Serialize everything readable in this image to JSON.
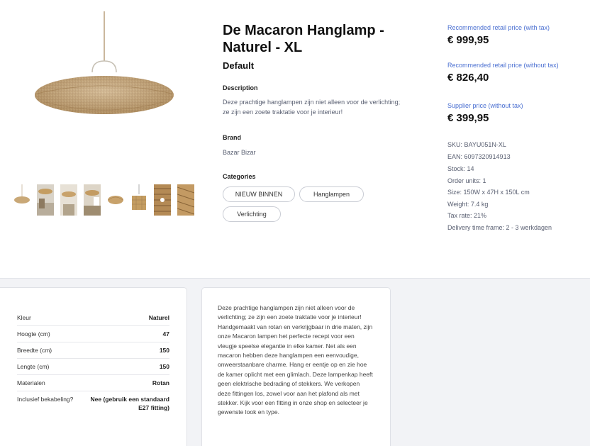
{
  "product": {
    "title": "De Macaron Hanglamp - Naturel - XL",
    "variant": "Default",
    "description_label": "Description",
    "description": "Deze prachtige hanglampen zijn niet alleen voor de verlichting; ze zijn een zoete traktatie voor je interieur!",
    "brand_label": "Brand",
    "brand": "Bazar Bizar",
    "categories_label": "Categories",
    "categories": [
      "NIEUW BINNEN",
      "Hanglampen",
      "Verlichting"
    ]
  },
  "pricing": {
    "retail_with_tax_label": "Recommended retail price (with tax)",
    "retail_with_tax": "€ 999,95",
    "retail_without_tax_label": "Recommended retail price (without tax)",
    "retail_without_tax": "€ 826,40",
    "supplier_label": "Supplier price (without tax)",
    "supplier": "€ 399,95"
  },
  "meta": {
    "sku": "SKU: BAYU051N-XL",
    "ean": "EAN: 6097320914913",
    "stock": "Stock: 14",
    "order_units": "Order units: 1",
    "size": "Size: 150W x 47H x 150L cm",
    "weight": "Weight: 7.4 kg",
    "tax_rate": "Tax rate: 21%",
    "delivery": "Delivery time frame: 2 - 3 werkdagen"
  },
  "specs": [
    {
      "key": "Kleur",
      "value": "Naturel"
    },
    {
      "key": "Hoogte (cm)",
      "value": "47"
    },
    {
      "key": "Breedte (cm)",
      "value": "150"
    },
    {
      "key": "Lengte (cm)",
      "value": "150"
    },
    {
      "key": "Materialen",
      "value": "Rotan"
    },
    {
      "key": "Inclusief bekabeling?",
      "value": "Nee (gebruik een standaard E27 fitting)"
    }
  ],
  "long_description": "Deze prachtige hanglampen zijn niet alleen voor de verlichting; ze zijn een zoete traktatie voor je interieur! Handgemaakt van rotan en verkrijgbaar in drie maten, zijn onze Macaron lampen het perfecte recept voor een vleugje speelse elegantie in elke kamer. Net als een macaron hebben deze hanglampen een eenvoudige, onweerstaanbare charme. Hang er eentje op en zie hoe de kamer oplicht met een glimlach. Deze lampenkap heeft geen elektrische bedrading of stekkers. We verkopen deze fittingen los, zowel voor aan het plafond als met stekker. Kijk voor een fitting in onze shop en selecteer je gewenste look en type.",
  "colors": {
    "accent_blue": "#4a6fd1",
    "rattan": "#c9a877",
    "page_bg": "#f2f3f6"
  }
}
